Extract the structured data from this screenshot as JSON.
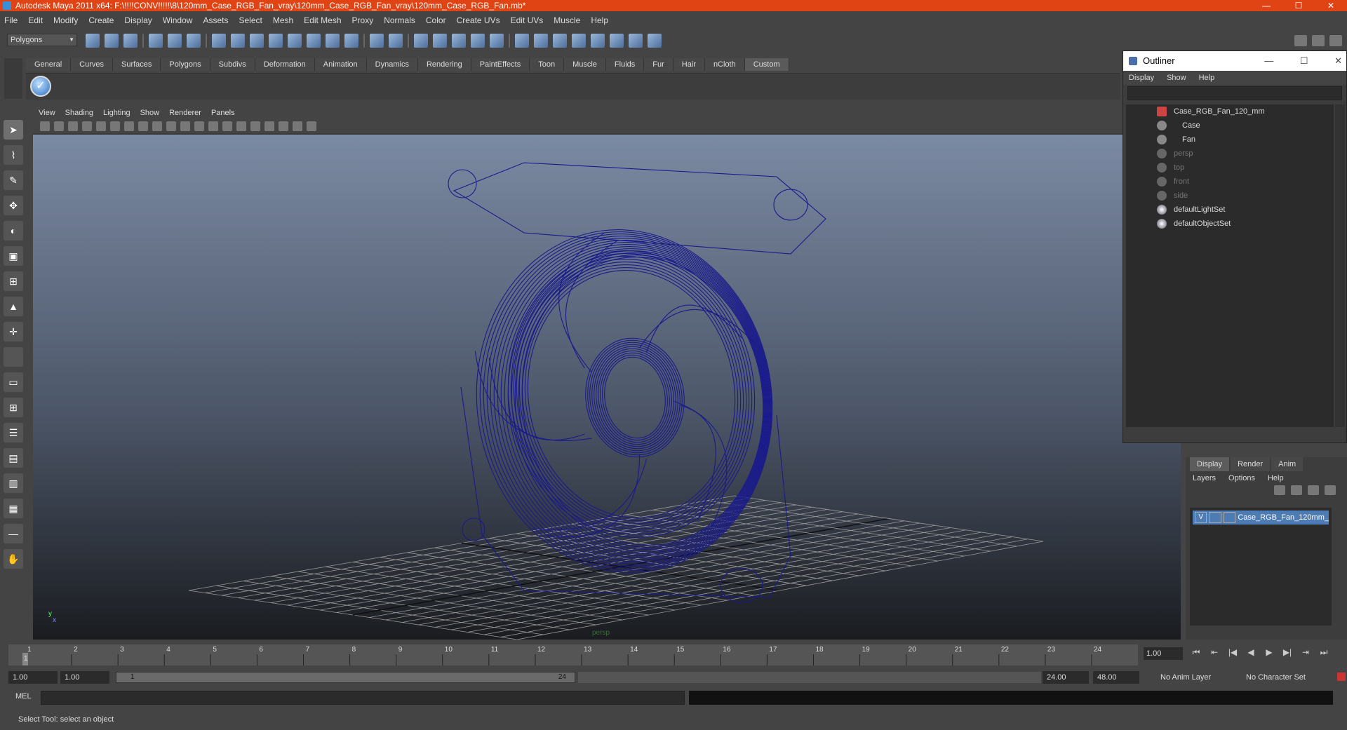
{
  "window": {
    "title": "Autodesk Maya 2011 x64: F:\\!!!!CONV!!!!!\\8\\120mm_Case_RGB_Fan_vray\\120mm_Case_RGB_Fan_vray\\120mm_Case_RGB_Fan.mb*"
  },
  "menubar": [
    "File",
    "Edit",
    "Modify",
    "Create",
    "Display",
    "Window",
    "Assets",
    "Select",
    "Mesh",
    "Edit Mesh",
    "Proxy",
    "Normals",
    "Color",
    "Create UVs",
    "Edit UVs",
    "Muscle",
    "Help"
  ],
  "statusline": {
    "mode": "Polygons"
  },
  "shelf_tabs": [
    "General",
    "Curves",
    "Surfaces",
    "Polygons",
    "Subdivs",
    "Deformation",
    "Animation",
    "Dynamics",
    "Rendering",
    "PaintEffects",
    "Toon",
    "Muscle",
    "Fluids",
    "Fur",
    "Hair",
    "nCloth",
    "Custom"
  ],
  "shelf_active": "Custom",
  "viewport": {
    "menu": [
      "View",
      "Shading",
      "Lighting",
      "Show",
      "Renderer",
      "Panels"
    ],
    "camera_label": "persp",
    "wire_color": "#1a1a8c"
  },
  "outliner": {
    "title": "Outliner",
    "menu": [
      "Display",
      "Show",
      "Help"
    ],
    "items": [
      {
        "label": "Case_RGB_Fan_120_mm",
        "dim": false,
        "icon": "group-icon"
      },
      {
        "label": "Case",
        "dim": false,
        "icon": "mesh-icon"
      },
      {
        "label": "Fan",
        "dim": false,
        "icon": "mesh-icon"
      },
      {
        "label": "persp",
        "dim": true,
        "icon": "camera-icon"
      },
      {
        "label": "top",
        "dim": true,
        "icon": "camera-icon"
      },
      {
        "label": "front",
        "dim": true,
        "icon": "camera-icon"
      },
      {
        "label": "side",
        "dim": true,
        "icon": "camera-icon"
      },
      {
        "label": "defaultLightSet",
        "dim": false,
        "icon": "set-icon"
      },
      {
        "label": "defaultObjectSet",
        "dim": false,
        "icon": "set-icon"
      }
    ]
  },
  "layers": {
    "tabs": [
      "Display",
      "Render",
      "Anim"
    ],
    "menu": [
      "Layers",
      "Options",
      "Help"
    ],
    "row": {
      "visible": "V",
      "name": "Case_RGB_Fan_120mm_"
    }
  },
  "timeline": {
    "ticks": [
      "1",
      "2",
      "3",
      "4",
      "5",
      "6",
      "7",
      "8",
      "9",
      "10",
      "11",
      "12",
      "13",
      "14",
      "15",
      "16",
      "17",
      "18",
      "19",
      "20",
      "21",
      "22",
      "23",
      "24"
    ],
    "current_frame": "1.00",
    "current_marker": "1"
  },
  "range": {
    "start": "1.00",
    "playback_start": "1.00",
    "bar_start": "1",
    "bar_end": "24",
    "playback_end": "24.00",
    "end": "48.00",
    "anim_layer": "No Anim Layer",
    "char_set": "No Character Set"
  },
  "command": {
    "label": "MEL"
  },
  "helpline": {
    "text": "Select Tool: select an object"
  }
}
